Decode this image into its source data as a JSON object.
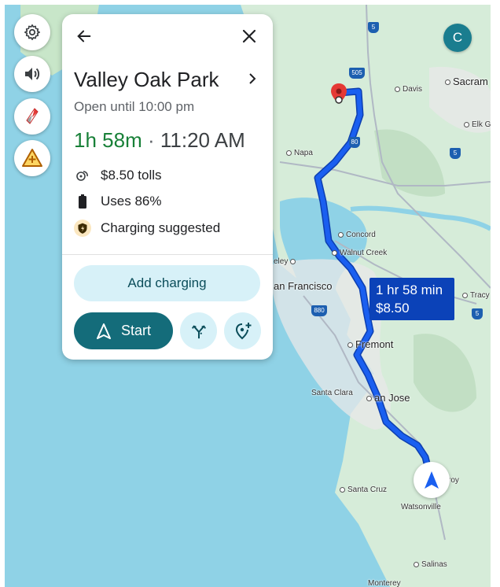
{
  "map": {
    "cities": {
      "sacramento": "Sacram",
      "davis": "Davis",
      "elk_grove": "Elk G",
      "napa": "Napa",
      "concord": "Concord",
      "walnut_creek": "Walnut Creek",
      "berkeley": "eley",
      "san_francisco": "an Francisco",
      "tracy": "Tracy",
      "fremont": "Fremont",
      "santa_clara": "Santa Clara",
      "san_jose": "an Jose",
      "santa_cruz": "Santa Cruz",
      "watsonville": "Watsonville",
      "gilroy": "roy",
      "salinas": "Salinas",
      "monterey": "Monterey"
    },
    "shields": {
      "i5_top": "5",
      "i505": "505",
      "i80": "80",
      "i5_mid": "5",
      "i880": "880",
      "i5_bottom": "5"
    },
    "route_label": {
      "duration": "1 hr 58 min",
      "toll": "$8.50"
    },
    "colors": {
      "land": "#d6ecd9",
      "water": "#8fd2e6",
      "route": "#1a5ff0",
      "route_outline": "#0d3fb0"
    }
  },
  "controls": {
    "settings_icon": "gear-icon",
    "sound_icon": "speaker-icon",
    "compass_icon": "compass-icon",
    "report_icon": "warning-plus-icon"
  },
  "account": {
    "avatar_letter": "C"
  },
  "card": {
    "destination": "Valley Oak Park",
    "hours": "Open until 10:00 pm",
    "duration": "1h 58m",
    "separator": "·",
    "arrival": "11:20 AM",
    "tolls": "$8.50 tolls",
    "battery": "Uses 86%",
    "charging_note": "Charging suggested",
    "add_charging_label": "Add charging",
    "start_label": "Start",
    "accent_color": "#146c7a",
    "duration_color": "#188038"
  }
}
